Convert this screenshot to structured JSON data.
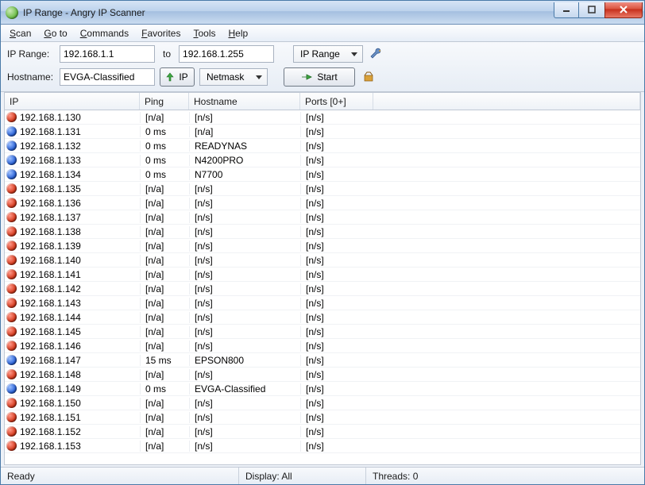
{
  "window": {
    "title": "IP Range - Angry IP Scanner"
  },
  "menus": [
    "Scan",
    "Go to",
    "Commands",
    "Favorites",
    "Tools",
    "Help"
  ],
  "toolbar": {
    "iprange_label": "IP Range:",
    "ip_from": "192.168.1.1",
    "to_label": "to",
    "ip_to": "192.168.1.255",
    "type_label": "IP Range",
    "hostname_label": "Hostname:",
    "hostname_value": "EVGA-Classified",
    "ip_button": "IP",
    "netmask_label": "Netmask",
    "start_label": "Start"
  },
  "columns": {
    "ip": "IP",
    "ping": "Ping",
    "host": "Hostname",
    "ports": "Ports [0+]"
  },
  "rows": [
    {
      "status": "red",
      "ip": "192.168.1.130",
      "ping": "[n/a]",
      "host": "[n/s]",
      "ports": "[n/s]"
    },
    {
      "status": "blue",
      "ip": "192.168.1.131",
      "ping": "0 ms",
      "host": "[n/a]",
      "ports": "[n/s]"
    },
    {
      "status": "blue",
      "ip": "192.168.1.132",
      "ping": "0 ms",
      "host": "READYNAS",
      "ports": "[n/s]"
    },
    {
      "status": "blue",
      "ip": "192.168.1.133",
      "ping": "0 ms",
      "host": "N4200PRO",
      "ports": "[n/s]"
    },
    {
      "status": "blue",
      "ip": "192.168.1.134",
      "ping": "0 ms",
      "host": "N7700",
      "ports": "[n/s]"
    },
    {
      "status": "red",
      "ip": "192.168.1.135",
      "ping": "[n/a]",
      "host": "[n/s]",
      "ports": "[n/s]"
    },
    {
      "status": "red",
      "ip": "192.168.1.136",
      "ping": "[n/a]",
      "host": "[n/s]",
      "ports": "[n/s]"
    },
    {
      "status": "red",
      "ip": "192.168.1.137",
      "ping": "[n/a]",
      "host": "[n/s]",
      "ports": "[n/s]"
    },
    {
      "status": "red",
      "ip": "192.168.1.138",
      "ping": "[n/a]",
      "host": "[n/s]",
      "ports": "[n/s]"
    },
    {
      "status": "red",
      "ip": "192.168.1.139",
      "ping": "[n/a]",
      "host": "[n/s]",
      "ports": "[n/s]"
    },
    {
      "status": "red",
      "ip": "192.168.1.140",
      "ping": "[n/a]",
      "host": "[n/s]",
      "ports": "[n/s]"
    },
    {
      "status": "red",
      "ip": "192.168.1.141",
      "ping": "[n/a]",
      "host": "[n/s]",
      "ports": "[n/s]"
    },
    {
      "status": "red",
      "ip": "192.168.1.142",
      "ping": "[n/a]",
      "host": "[n/s]",
      "ports": "[n/s]"
    },
    {
      "status": "red",
      "ip": "192.168.1.143",
      "ping": "[n/a]",
      "host": "[n/s]",
      "ports": "[n/s]"
    },
    {
      "status": "red",
      "ip": "192.168.1.144",
      "ping": "[n/a]",
      "host": "[n/s]",
      "ports": "[n/s]"
    },
    {
      "status": "red",
      "ip": "192.168.1.145",
      "ping": "[n/a]",
      "host": "[n/s]",
      "ports": "[n/s]"
    },
    {
      "status": "red",
      "ip": "192.168.1.146",
      "ping": "[n/a]",
      "host": "[n/s]",
      "ports": "[n/s]"
    },
    {
      "status": "blue",
      "ip": "192.168.1.147",
      "ping": "15 ms",
      "host": "EPSON800",
      "ports": "[n/s]"
    },
    {
      "status": "red",
      "ip": "192.168.1.148",
      "ping": "[n/a]",
      "host": "[n/s]",
      "ports": "[n/s]"
    },
    {
      "status": "blue",
      "ip": "192.168.1.149",
      "ping": "0 ms",
      "host": "EVGA-Classified",
      "ports": "[n/s]"
    },
    {
      "status": "red",
      "ip": "192.168.1.150",
      "ping": "[n/a]",
      "host": "[n/s]",
      "ports": "[n/s]"
    },
    {
      "status": "red",
      "ip": "192.168.1.151",
      "ping": "[n/a]",
      "host": "[n/s]",
      "ports": "[n/s]"
    },
    {
      "status": "red",
      "ip": "192.168.1.152",
      "ping": "[n/a]",
      "host": "[n/s]",
      "ports": "[n/s]"
    },
    {
      "status": "red",
      "ip": "192.168.1.153",
      "ping": "[n/a]",
      "host": "[n/s]",
      "ports": "[n/s]"
    }
  ],
  "status": {
    "ready": "Ready",
    "display": "Display: All",
    "threads": "Threads: 0"
  }
}
